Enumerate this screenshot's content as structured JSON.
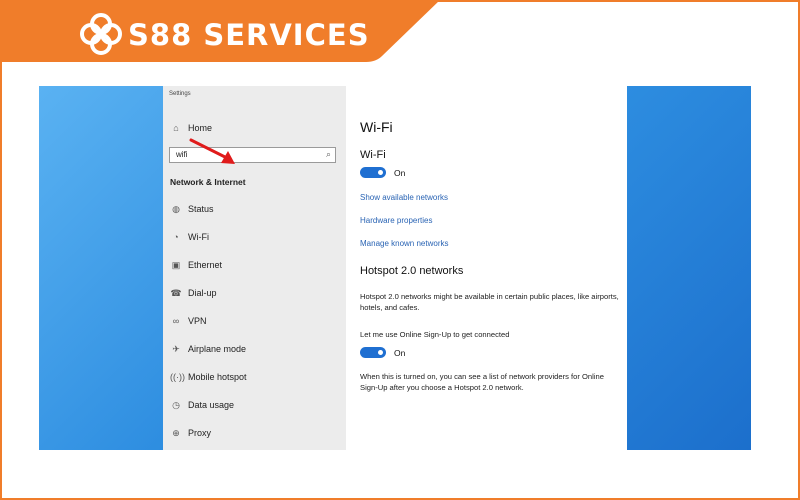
{
  "brand": {
    "name": "S88 SERVICES",
    "logo_icon": "quatrefoil-logo-icon",
    "color": "#f07d2a"
  },
  "settings": {
    "window_title": "Settings",
    "home_label": "Home",
    "search": {
      "value": "wifi"
    },
    "section_title": "Network & Internet",
    "nav_items": [
      {
        "label": "Status",
        "icon": "globe-icon"
      },
      {
        "label": "Wi-Fi",
        "icon": "wifi-icon"
      },
      {
        "label": "Ethernet",
        "icon": "ethernet-icon"
      },
      {
        "label": "Dial-up",
        "icon": "phone-icon"
      },
      {
        "label": "VPN",
        "icon": "vpn-icon"
      },
      {
        "label": "Airplane mode",
        "icon": "airplane-icon"
      },
      {
        "label": "Mobile hotspot",
        "icon": "hotspot-icon"
      },
      {
        "label": "Data usage",
        "icon": "data-usage-icon"
      },
      {
        "label": "Proxy",
        "icon": "proxy-icon"
      }
    ]
  },
  "content": {
    "page_title": "Wi-Fi",
    "wifi_label": "Wi-Fi",
    "wifi_toggle": {
      "state": "On"
    },
    "links": [
      "Show available networks",
      "Hardware properties",
      "Manage known networks"
    ],
    "hotspot_heading": "Hotspot 2.0 networks",
    "hotspot_desc": "Hotspot 2.0 networks might be available in certain public places, like airports, hotels, and cafes.",
    "signup_label": "Let me use Online Sign-Up to get connected",
    "signup_toggle": {
      "state": "On"
    },
    "signup_desc": "When this is turned on, you can see a list of network providers for Online Sign-Up after you choose a Hotspot 2.0 network."
  },
  "colors": {
    "accent": "#1f6fd1",
    "link": "#2a64b4",
    "arrow": "#e01b1b"
  }
}
